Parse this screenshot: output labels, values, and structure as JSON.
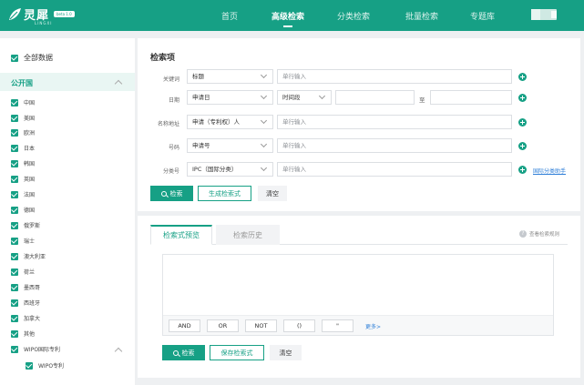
{
  "header": {
    "logo_text": "灵犀",
    "logo_sub": "LINGXI",
    "beta": "beta 1.0",
    "nav": [
      "首页",
      "高级检索",
      "分类检索",
      "批量检索",
      "专题库"
    ],
    "active_nav_index": 1
  },
  "sidebar": {
    "all_label": "全部数据",
    "section_label": "公开国",
    "countries": [
      "中国",
      "美国",
      "欧洲",
      "日本",
      "韩国",
      "英国",
      "法国",
      "德国",
      "俄罗斯",
      "瑞士",
      "澳大利亚",
      "荷兰",
      "墨西哥",
      "西班牙",
      "加拿大",
      "其他"
    ],
    "wipo_label": "WIPO国际专利",
    "wipo_sub_label": "WIPO专利"
  },
  "search_form": {
    "title": "检索项",
    "rows": [
      {
        "label": "关键词",
        "select": "标题",
        "placeholder": "单行输入"
      },
      {
        "label": "日期",
        "select": "申请日",
        "sub_select": "时间段",
        "range_sep": "至"
      },
      {
        "label": "名称地址",
        "select": "申请（专利权）人",
        "placeholder": "单行输入"
      },
      {
        "label": "号码",
        "select": "申请号",
        "placeholder": "单行输入"
      },
      {
        "label": "分类号",
        "select": "IPC（国际分类）",
        "placeholder": "单行输入",
        "link": "国际分类助手"
      }
    ],
    "search_button": "检索",
    "generate_button": "生成检索式",
    "clear_button": "清空"
  },
  "preview": {
    "tabs": [
      "检索式预览",
      "检索历史"
    ],
    "active_tab_index": 0,
    "help_text": "查看检索规则",
    "operators": [
      "AND",
      "OR",
      "NOT",
      "()",
      "\""
    ],
    "more_link": "更多>",
    "search_button": "检索",
    "save_button": "保存检索式",
    "clear_button": "清空"
  },
  "colors": {
    "primary": "#16a085",
    "link": "#2f7fd8"
  }
}
